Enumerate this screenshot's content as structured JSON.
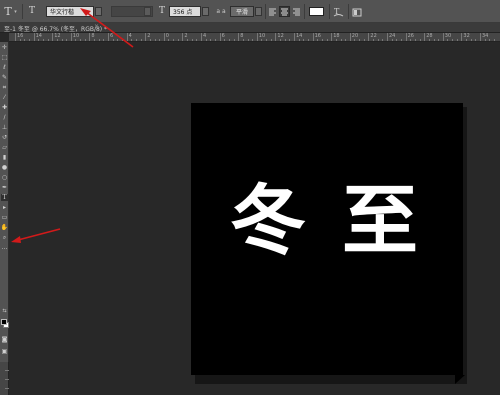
{
  "options_bar": {
    "tool_icon": "T",
    "orientation_icon": "T",
    "font_family": "华文行楷",
    "font_style": "",
    "size_icon": "T",
    "font_size": "356 点",
    "aa_icon": "a a",
    "antialias": "平滑",
    "align_icons": [
      "align-left-icon",
      "align-center-icon",
      "align-right-icon"
    ],
    "text_color": "#ffffff",
    "warp_icon": "warp-text-icon",
    "panels_icon": "character-panel-icon"
  },
  "document_tab": {
    "title": "冬至 @ 66.7% (冬至，RGB/8) *",
    "prefix": "至-1",
    "close": "×"
  },
  "ruler": {
    "labels": [
      "16",
      "14",
      "12",
      "10",
      "8",
      "6",
      "4",
      "2",
      "0",
      "2",
      "4",
      "6",
      "8",
      "10",
      "12",
      "14",
      "16",
      "18",
      "20",
      "22",
      "24",
      "26",
      "28",
      "30",
      "32",
      "34"
    ]
  },
  "canvas": {
    "text": "冬至",
    "background": "#000000",
    "text_color": "#ffffff"
  },
  "annotations": {
    "arrow_color": "#d21a1a"
  }
}
